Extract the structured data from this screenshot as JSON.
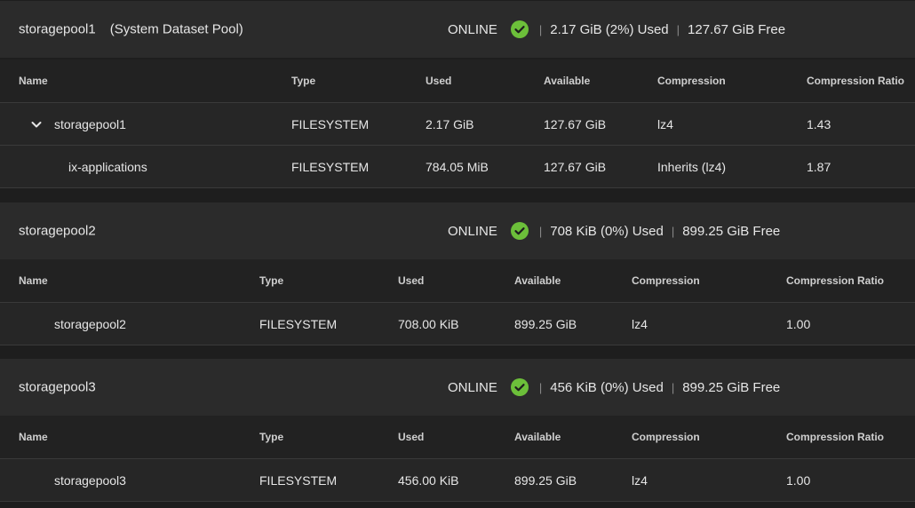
{
  "colors": {
    "ok": "#6cbf3a",
    "background": "#1e1e1e",
    "header": "#2b2b2b"
  },
  "columns": [
    "Name",
    "Type",
    "Used",
    "Available",
    "Compression",
    "Compression Ratio"
  ],
  "pools": [
    {
      "name": "storagepool1",
      "tag": "(System Dataset Pool)",
      "status": "ONLINE",
      "used": "2.17 GiB (2%) Used",
      "free": "127.67 GiB Free",
      "rows": [
        {
          "name": "storagepool1",
          "type": "FILESYSTEM",
          "used": "2.17 GiB",
          "available": "127.67 GiB",
          "compression": "lz4",
          "ratio": "1.43"
        },
        {
          "name": "ix-applications",
          "type": "FILESYSTEM",
          "used": "784.05 MiB",
          "available": "127.67 GiB",
          "compression": "Inherits (lz4)",
          "ratio": "1.87"
        }
      ]
    },
    {
      "name": "storagepool2",
      "status": "ONLINE",
      "used": "708 KiB (0%) Used",
      "free": "899.25 GiB Free",
      "rows": [
        {
          "name": "storagepool2",
          "type": "FILESYSTEM",
          "used": "708.00 KiB",
          "available": "899.25 GiB",
          "compression": "lz4",
          "ratio": "1.00"
        }
      ]
    },
    {
      "name": "storagepool3",
      "status": "ONLINE",
      "used": "456 KiB (0%) Used",
      "free": "899.25 GiB Free",
      "rows": [
        {
          "name": "storagepool3",
          "type": "FILESYSTEM",
          "used": "456.00 KiB",
          "available": "899.25 GiB",
          "compression": "lz4",
          "ratio": "1.00"
        }
      ]
    }
  ]
}
